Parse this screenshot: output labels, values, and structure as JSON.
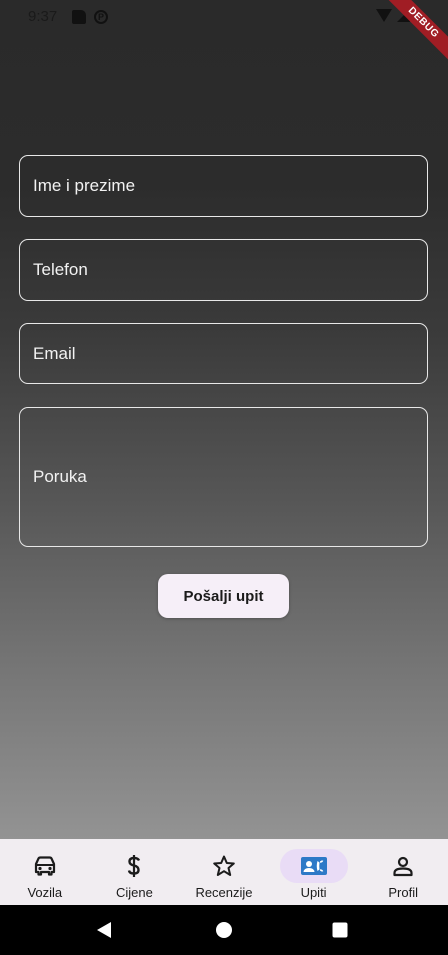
{
  "status_bar": {
    "time": "9:37",
    "icons": [
      "sd-card-icon",
      "p-icon",
      "wifi-icon",
      "signal-icon"
    ]
  },
  "debug_banner": "DEBUG",
  "form": {
    "name_placeholder": "Ime i prezime",
    "phone_placeholder": "Telefon",
    "email_placeholder": "Email",
    "message_placeholder": "Poruka",
    "submit_label": "Pošalji upit"
  },
  "bottom_nav": {
    "active_index": 3,
    "accent_color": "#2d79c7",
    "items": [
      {
        "label": "Vozila",
        "icon": "car-icon"
      },
      {
        "label": "Cijene",
        "icon": "dollar-icon"
      },
      {
        "label": "Recenzije",
        "icon": "star-icon"
      },
      {
        "label": "Upiti",
        "icon": "contact-card-icon"
      },
      {
        "label": "Profil",
        "icon": "person-icon"
      }
    ]
  },
  "system_nav": [
    "back-icon",
    "home-icon",
    "recents-icon"
  ]
}
